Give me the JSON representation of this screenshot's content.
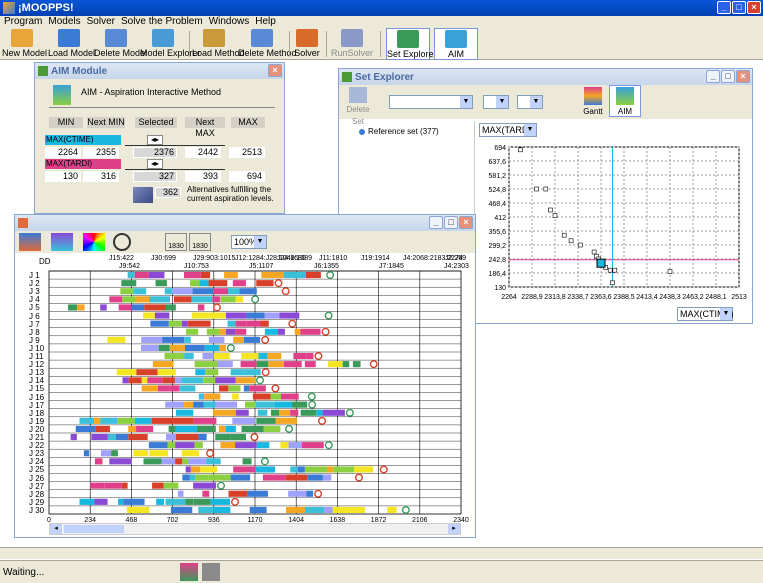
{
  "app": {
    "title": "¡MOOPPS!"
  },
  "menu": [
    "Program",
    "Models",
    "Solver",
    "Solve the Problem",
    "Windows",
    "Help"
  ],
  "toolbar": [
    {
      "label": "New Model",
      "icon": "new-model-icon",
      "color": "#e9a43a",
      "disabled": false
    },
    {
      "label": "Load Model",
      "icon": "load-model-icon",
      "color": "#3a7bd5",
      "disabled": false
    },
    {
      "label": "Delete Model",
      "icon": "delete-model-icon",
      "color": "#5a8ad5",
      "disabled": false
    },
    {
      "label": "Model Explorer",
      "icon": "model-explorer-icon",
      "color": "#4a9ad5",
      "disabled": false
    },
    {
      "label": "Load Method",
      "icon": "load-method-icon",
      "color": "#c89a3a",
      "disabled": false
    },
    {
      "label": "Delete Method",
      "icon": "delete-method-icon",
      "color": "#5a8ad5",
      "disabled": false
    },
    {
      "label": "Solver",
      "icon": "solver-icon",
      "color": "#d86a2a",
      "disabled": false
    },
    {
      "label": "RunSolver",
      "icon": "run-solver-icon",
      "color": "#8a9ac8",
      "disabled": true
    },
    {
      "label": "Set Explorer",
      "icon": "set-explorer-icon",
      "color": "#3a9a5a",
      "disabled": false
    },
    {
      "label": "AIM",
      "icon": "aim-icon",
      "color": "#3aa0d8",
      "disabled": false
    }
  ],
  "aim": {
    "title": "AIM Module",
    "subtitle": "AIM - Aspiration Interactive Method",
    "headers": [
      "MIN",
      "Next MIN",
      "Selected",
      "Next MAX",
      "MAX"
    ],
    "obj1": {
      "name": "MAX(CTIME)",
      "min": "2264",
      "next_min": "2355",
      "selected": "2376",
      "next_max": "2442",
      "max": "2513",
      "color": "#19b8e0"
    },
    "obj2": {
      "name": "MAX(TARDI)",
      "min": "130",
      "next_min": "316",
      "selected": "327",
      "next_max": "393",
      "max": "694",
      "color": "#e0408a"
    },
    "alternatives": "362",
    "alt_text1": "Alternatives fulfilling the",
    "alt_text2": "current aspiration levels."
  },
  "setexp": {
    "title": "Set Explorer",
    "delete_label": "Delete Set",
    "gantt_label": "Gantt",
    "aim_label": "AIM",
    "tree_item": "Reference set (377)",
    "y_combo": "MAX(TARDI)",
    "x_combo": "MAX(CTIME)",
    "y_ticks": [
      "694",
      "637,6",
      "581,2",
      "524,8",
      "468,4",
      "412",
      "355,6",
      "299,2",
      "242,8",
      "186,4",
      "130"
    ],
    "x_ticks": [
      "2264",
      "2288,9",
      "2313,8",
      "2338,7",
      "2363,6",
      "2388,5",
      "2413,4",
      "2438,3",
      "2463,2",
      "2488,1",
      "2513"
    ]
  },
  "gantt": {
    "zoom": "100%",
    "btn_a": "1830",
    "btn_b": "1830",
    "dd_label": "DD",
    "jobs": [
      "J 1",
      "J 2",
      "J 3",
      "J 4",
      "J 5",
      "J 6",
      "J 7",
      "J 8",
      "J 9",
      "J 10",
      "J 11",
      "J 12",
      "J 13",
      "J 14",
      "J 15",
      "J 16",
      "J 17",
      "J 18",
      "J 19",
      "J 20",
      "J 21",
      "J 22",
      "J 23",
      "J 24",
      "J 25",
      "J 26",
      "J 27",
      "J 28",
      "J 29",
      "J 30"
    ],
    "x_ticks": [
      "0",
      "234",
      "468",
      "702",
      "936",
      "1170",
      "1404",
      "1638",
      "1872",
      "2106",
      "2340"
    ],
    "dd_row1": [
      "J15:422",
      "J30:699",
      "J29:903:1015",
      "J12:1284:J28:1048:1089",
      "J24:1680",
      "J11:1810",
      "J19:1914",
      "J4:2068:2183:2274",
      "J2:269"
    ],
    "dd_row2": [
      "J9:542",
      "J10:753",
      "J5:1107",
      "J6:1355",
      "J7:1845",
      "J4:2303"
    ]
  },
  "status": "Waiting..."
}
